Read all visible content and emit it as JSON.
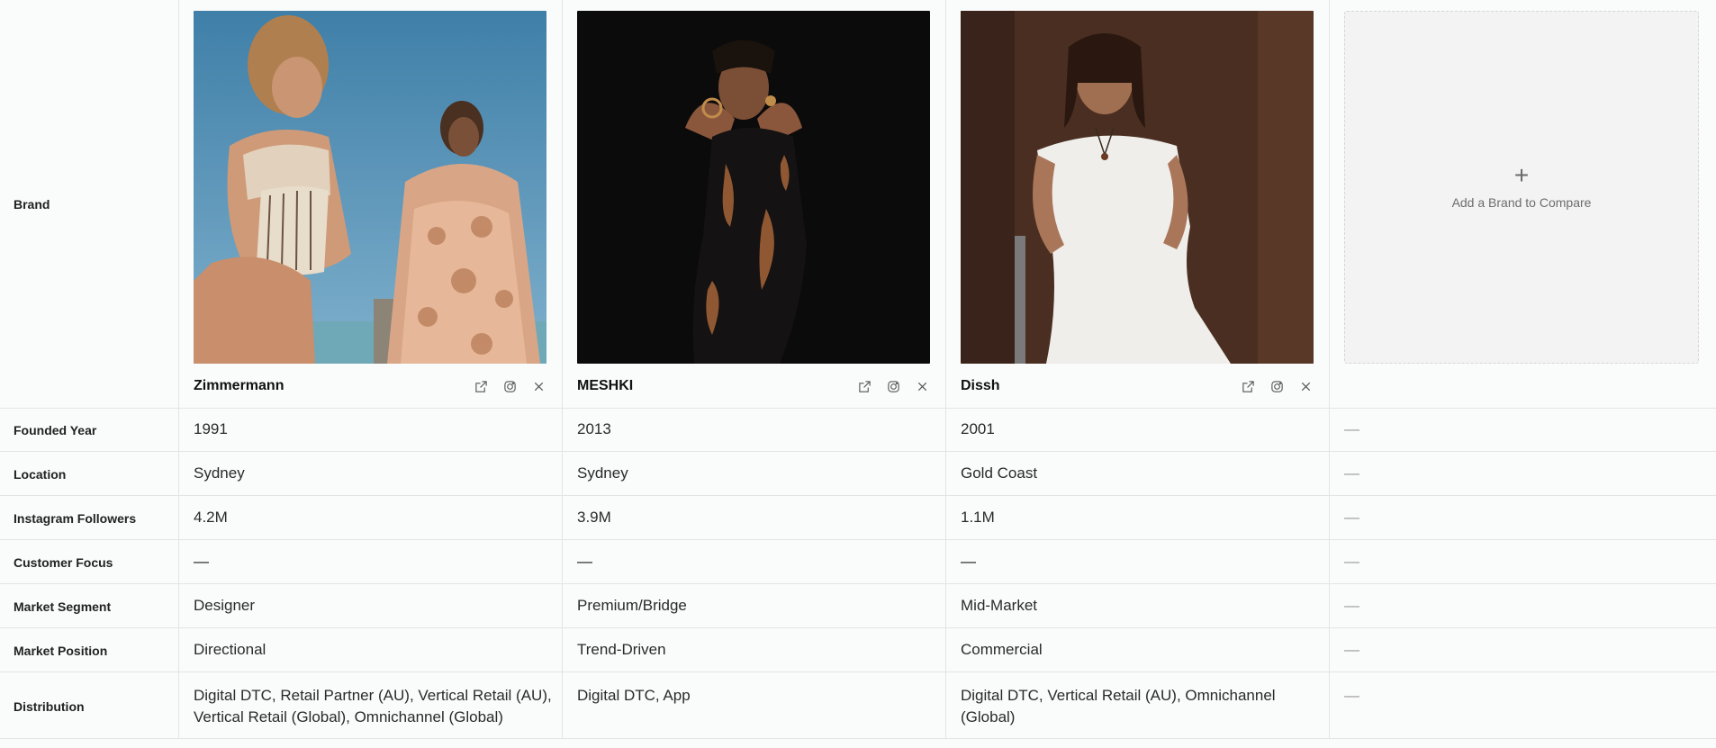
{
  "row_labels": {
    "brand": "Brand",
    "founded": "Founded Year",
    "location": "Location",
    "instagram": "Instagram Followers",
    "customer_focus": "Customer Focus",
    "market_segment": "Market Segment",
    "market_position": "Market Position",
    "distribution": "Distribution"
  },
  "brands": [
    {
      "name": "Zimmermann",
      "founded": "1991",
      "location": "Sydney",
      "instagram": "4.2M",
      "customer_focus": "—",
      "market_segment": "Designer",
      "market_position": "Directional",
      "distribution": "Digital DTC, Retail Partner (AU), Vertical Retail (AU), Vertical Retail (Global), Omnichannel (Global)"
    },
    {
      "name": "MESHKI",
      "founded": "2013",
      "location": "Sydney",
      "instagram": "3.9M",
      "customer_focus": "—",
      "market_segment": "Premium/Bridge",
      "market_position": "Trend-Driven",
      "distribution": "Digital DTC, App"
    },
    {
      "name": "Dissh",
      "founded": "2001",
      "location": "Gold Coast",
      "instagram": "1.1M",
      "customer_focus": "—",
      "market_segment": "Mid-Market",
      "market_position": "Commercial",
      "distribution": "Digital DTC, Vertical Retail (AU), Omnichannel (Global)"
    }
  ],
  "add_slot": {
    "plus": "+",
    "label": "Add a Brand to Compare",
    "empty_value": "—"
  },
  "icons": [
    "external-link-icon",
    "instagram-icon",
    "close-icon"
  ]
}
